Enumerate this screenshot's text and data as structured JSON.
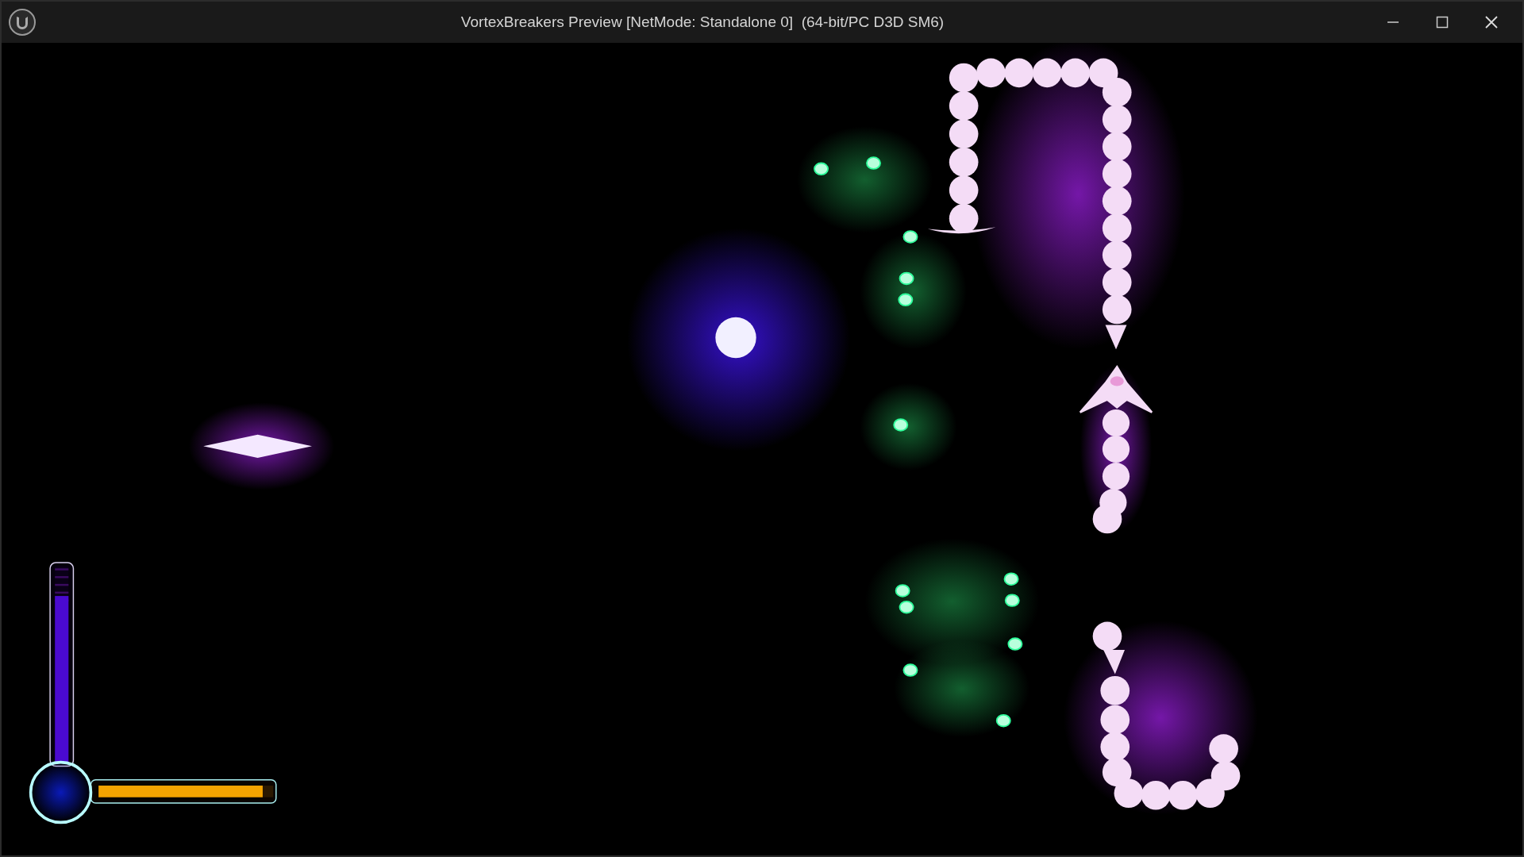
{
  "window": {
    "title": "VortexBreakers Preview [NetMode: Standalone 0]  (64-bit/PC D3D SM6)"
  },
  "hud": {
    "energy_bar": {
      "level": 0.85
    },
    "charge_bar": {
      "level": 0.94
    }
  }
}
